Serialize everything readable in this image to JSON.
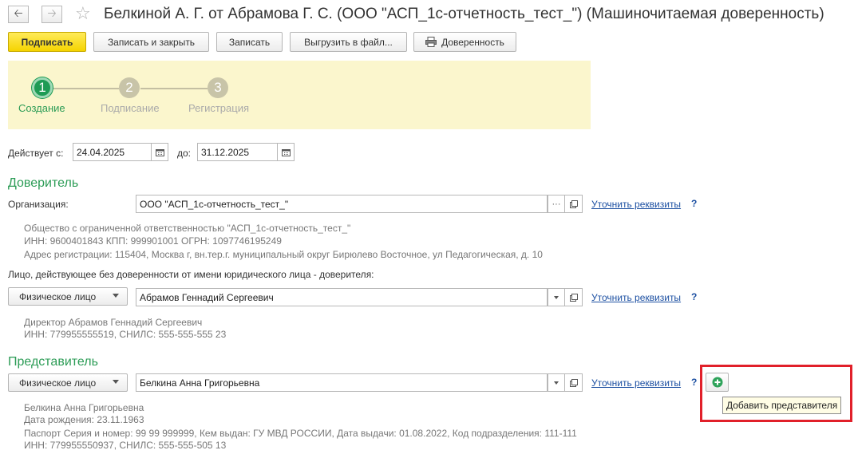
{
  "window": {
    "title": "Белкиной А. Г. от Абрамова Г. С. (ООО \"АСП_1с-отчетность_тест_\") (Машиночитаемая доверенность)"
  },
  "toolbar": {
    "sign": "Подписать",
    "save_close": "Записать и закрыть",
    "save": "Записать",
    "export": "Выгрузить в файл...",
    "power_of_attorney": "Доверенность"
  },
  "steps": [
    {
      "num": "1",
      "label": "Создание",
      "active": true
    },
    {
      "num": "2",
      "label": "Подписание",
      "active": false
    },
    {
      "num": "3",
      "label": "Регистрация",
      "active": false
    }
  ],
  "validity": {
    "from_label": "Действует с:",
    "from_value": "24.04.2025",
    "to_label": "до:",
    "to_value": "31.12.2025"
  },
  "principal": {
    "section_title": "Доверитель",
    "org_label": "Организация:",
    "org_value": "ООО \"АСП_1с-отчетность_тест_\"",
    "clarify_link": "Уточнить реквизиты",
    "help": "?",
    "info_lines": [
      "Общество с ограниченной ответственностью \"АСП_1с-отчетность_тест_\"",
      "ИНН: 9600401843 КПП: 999901001 ОГРН: 1097746195249",
      "Адрес регистрации: 115404, Москва г, вн.тер.г. муниципальный округ Бирюлево Восточное, ул Педагогическая, д. 10"
    ],
    "person_label": "Лицо, действующее без доверенности от имени юридического лица - доверителя:",
    "person_type": "Физическое лицо",
    "person_value": "Абрамов Геннадий Сергеевич",
    "person_info_lines": [
      "Директор Абрамов Геннадий Сергеевич",
      "ИНН: 779955555519, СНИЛС: 555-555-555 23"
    ]
  },
  "representative": {
    "section_title": "Представитель",
    "person_type": "Физическое лицо",
    "person_value": "Белкина Анна Григорьевна",
    "clarify_link": "Уточнить реквизиты",
    "help": "?",
    "info_lines": [
      "Белкина Анна Григорьевна",
      "Дата рождения: 23.11.1963",
      "Паспорт Серия и номер: 99 99 999999, Кем выдан: ГУ МВД РОССИИ, Дата выдачи: 01.08.2022, Код подразделения: 111-111",
      "ИНН: 779955550937, СНИЛС: 555-555-505 13"
    ],
    "add_tooltip": "Добавить представителя"
  },
  "colors": {
    "accent_green": "#2c9c56",
    "primary_button": "#f5d400",
    "link": "#1d50a2",
    "highlight_red": "#e1202a",
    "steps_background": "#fbf6cd"
  }
}
